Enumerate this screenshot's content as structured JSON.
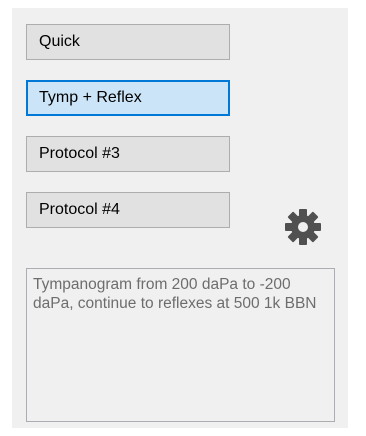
{
  "protocol_buttons": [
    {
      "label": "Quick",
      "selected": false
    },
    {
      "label": "Tymp + Reflex",
      "selected": true
    },
    {
      "label": "Protocol #3",
      "selected": false
    },
    {
      "label": "Protocol #4",
      "selected": false
    }
  ],
  "settings": {
    "icon": "gear-icon",
    "color": "#505050"
  },
  "description": {
    "text": "Tympanogram from 200 daPa to -200 daPa, continue to reflexes at 500 1k BBN"
  },
  "colors": {
    "selected_fill": "#cce4f7",
    "selected_border": "#0078d7",
    "button_fill": "#e1e1e1",
    "panel_bg": "#f0f0f0"
  }
}
